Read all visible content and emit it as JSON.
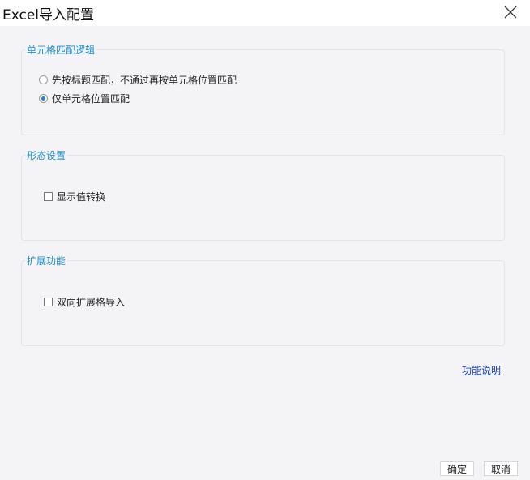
{
  "window": {
    "title": "Excel导入配置",
    "close_icon": "close-icon"
  },
  "groups": {
    "cell_match": {
      "legend": "单元格匹配逻辑",
      "options": [
        {
          "label": "先按标题匹配，不通过再按单元格位置匹配",
          "type": "radio",
          "checked": false
        },
        {
          "label": "仅单元格位置匹配",
          "type": "radio",
          "checked": true
        }
      ]
    },
    "form": {
      "legend": "形态设置",
      "options": [
        {
          "label": "显示值转换",
          "type": "checkbox",
          "checked": false
        }
      ]
    },
    "extension": {
      "legend": "扩展功能",
      "options": [
        {
          "label": "双向扩展格导入",
          "type": "checkbox",
          "checked": false
        }
      ]
    }
  },
  "help_link": "功能说明",
  "buttons": {
    "ok": "确定",
    "cancel": "取消"
  },
  "colors": {
    "legend": "#1f8fcf",
    "link": "#1a3fb3",
    "background": "#f4f4f7",
    "radio_selected": "#2a7fd4"
  }
}
